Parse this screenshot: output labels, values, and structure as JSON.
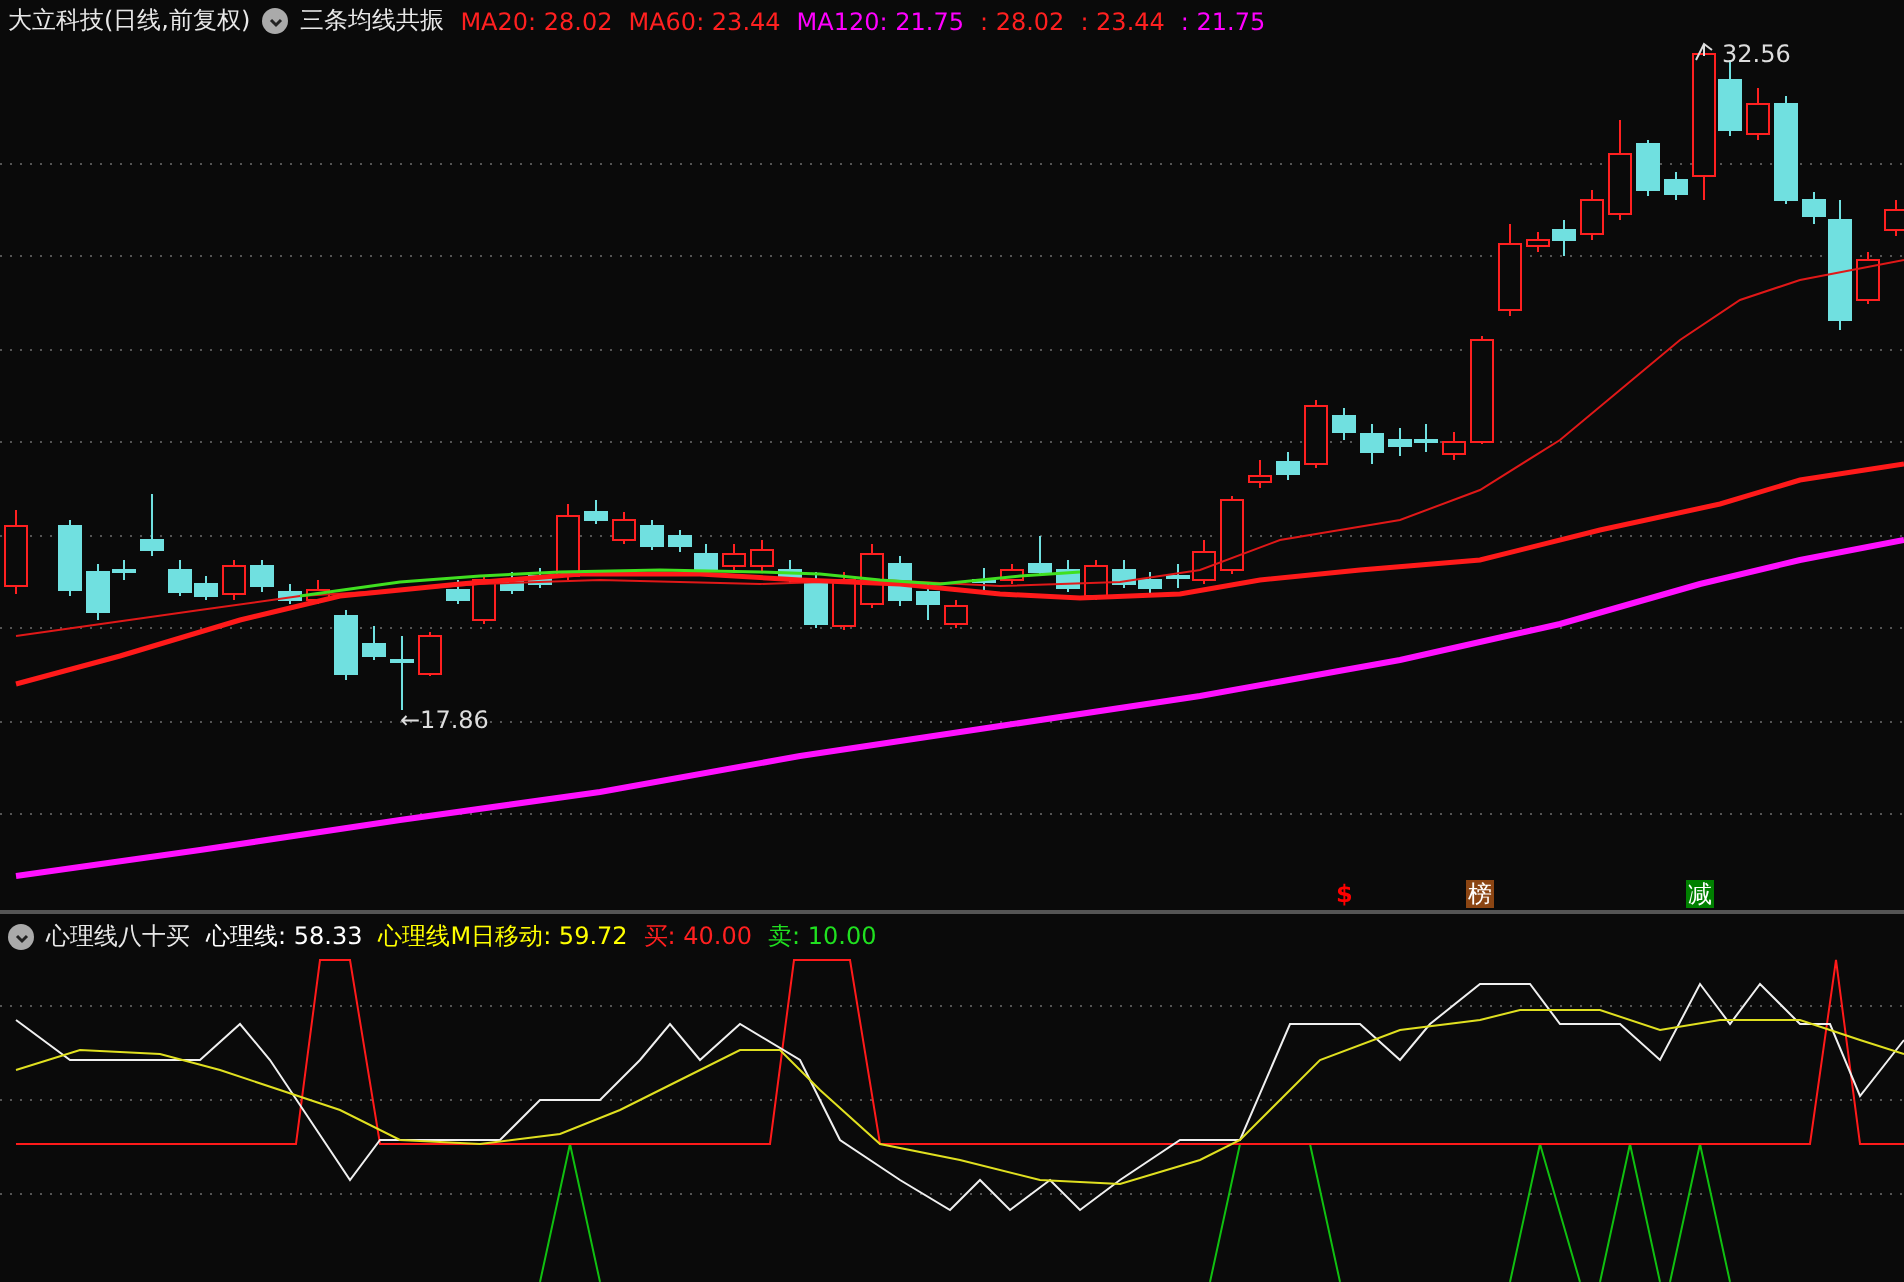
{
  "main_panel": {
    "title": "大立科技(日线,前复权)",
    "indicator": "三条均线共振",
    "averages": [
      {
        "label": "MA20: 28.02",
        "color": "#ff2020"
      },
      {
        "label": "MA60: 23.44",
        "color": "#ff2020"
      },
      {
        "label": "MA120: 21.75",
        "color": "#ff00ff"
      },
      {
        "label": ": 28.02",
        "color": "#ff2020"
      },
      {
        "label": ": 23.44",
        "color": "#ff2020"
      },
      {
        "label": ": 21.75",
        "color": "#ff00ff"
      }
    ],
    "high_label": "32.56",
    "low_label": "←17.86",
    "markers": [
      {
        "text": "$",
        "kind": "plain",
        "color": "#ff0000"
      },
      {
        "text": "榜",
        "kind": "badge",
        "color": "#8b4513"
      },
      {
        "text": "减",
        "kind": "badge",
        "color": "#008000"
      }
    ]
  },
  "lower_panel": {
    "indicator": "心理线八十买",
    "readings": [
      {
        "label": "心理线: 58.33",
        "color": "#ffffff"
      },
      {
        "label": "心理线M日移动: 59.72",
        "color": "#ffff00"
      },
      {
        "label": "买: 40.00",
        "color": "#ff2020"
      },
      {
        "label": "卖: 10.00",
        "color": "#20e020"
      }
    ]
  }
}
